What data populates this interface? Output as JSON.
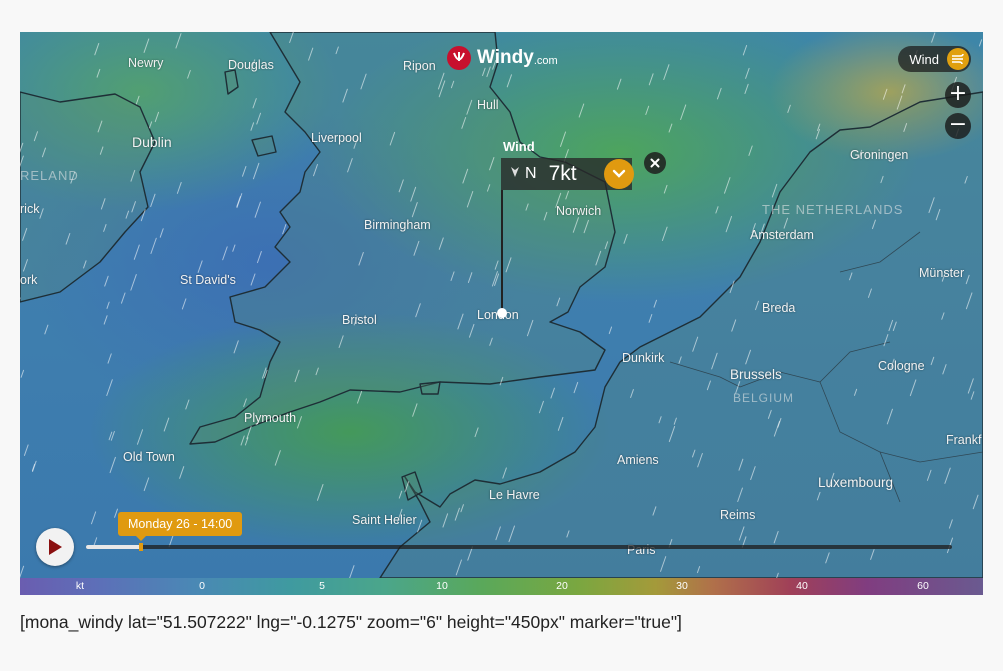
{
  "brand": {
    "name": "Windy",
    "suffix": ".com"
  },
  "layer": {
    "label": "Wind",
    "accent": "#e09a10"
  },
  "zoom": {
    "in_label": "+",
    "out_label": "−"
  },
  "picker": {
    "title": "Wind",
    "direction": "N",
    "speed": "7kt"
  },
  "timeline": {
    "time_label": "Monday 26 - 14:00",
    "progress": 0.063
  },
  "places": {
    "newry": "Newry",
    "douglas": "Douglas",
    "ripon": "Ripon",
    "hull": "Hull",
    "dublin": "Dublin",
    "liverpool": "Liverpool",
    "ireland": "RELAND",
    "limerick": "rick",
    "groningen": "Groningen",
    "netherlands": "THE NETHERLANDS",
    "norwich": "Norwich",
    "birmingham": "Birmingham",
    "amsterdam": "Amsterdam",
    "cork": "ork",
    "st_davids": "St David's",
    "munster": "Münster",
    "bristol": "Bristol",
    "london": "London",
    "breda": "Breda",
    "dunkirk": "Dunkirk",
    "cologne": "Cologne",
    "brussels": "Brussels",
    "belgium": "BELGIUM",
    "plymouth": "Plymouth",
    "frankfurt": "Frankf",
    "old_town": "Old Town",
    "amiens": "Amiens",
    "luxembourg": "Luxembourg",
    "le_havre": "Le Havre",
    "saint_helier": "Saint Helier",
    "reims": "Reims",
    "paris": "Paris"
  },
  "legend": {
    "unit": "kt",
    "ticks": [
      "0",
      "5",
      "10",
      "20",
      "30",
      "40",
      "60"
    ]
  },
  "shortcode": "[mona_windy lat=\"51.507222\" lng=\"-0.1275\" zoom=\"6\" height=\"450px\" marker=\"true\"]"
}
